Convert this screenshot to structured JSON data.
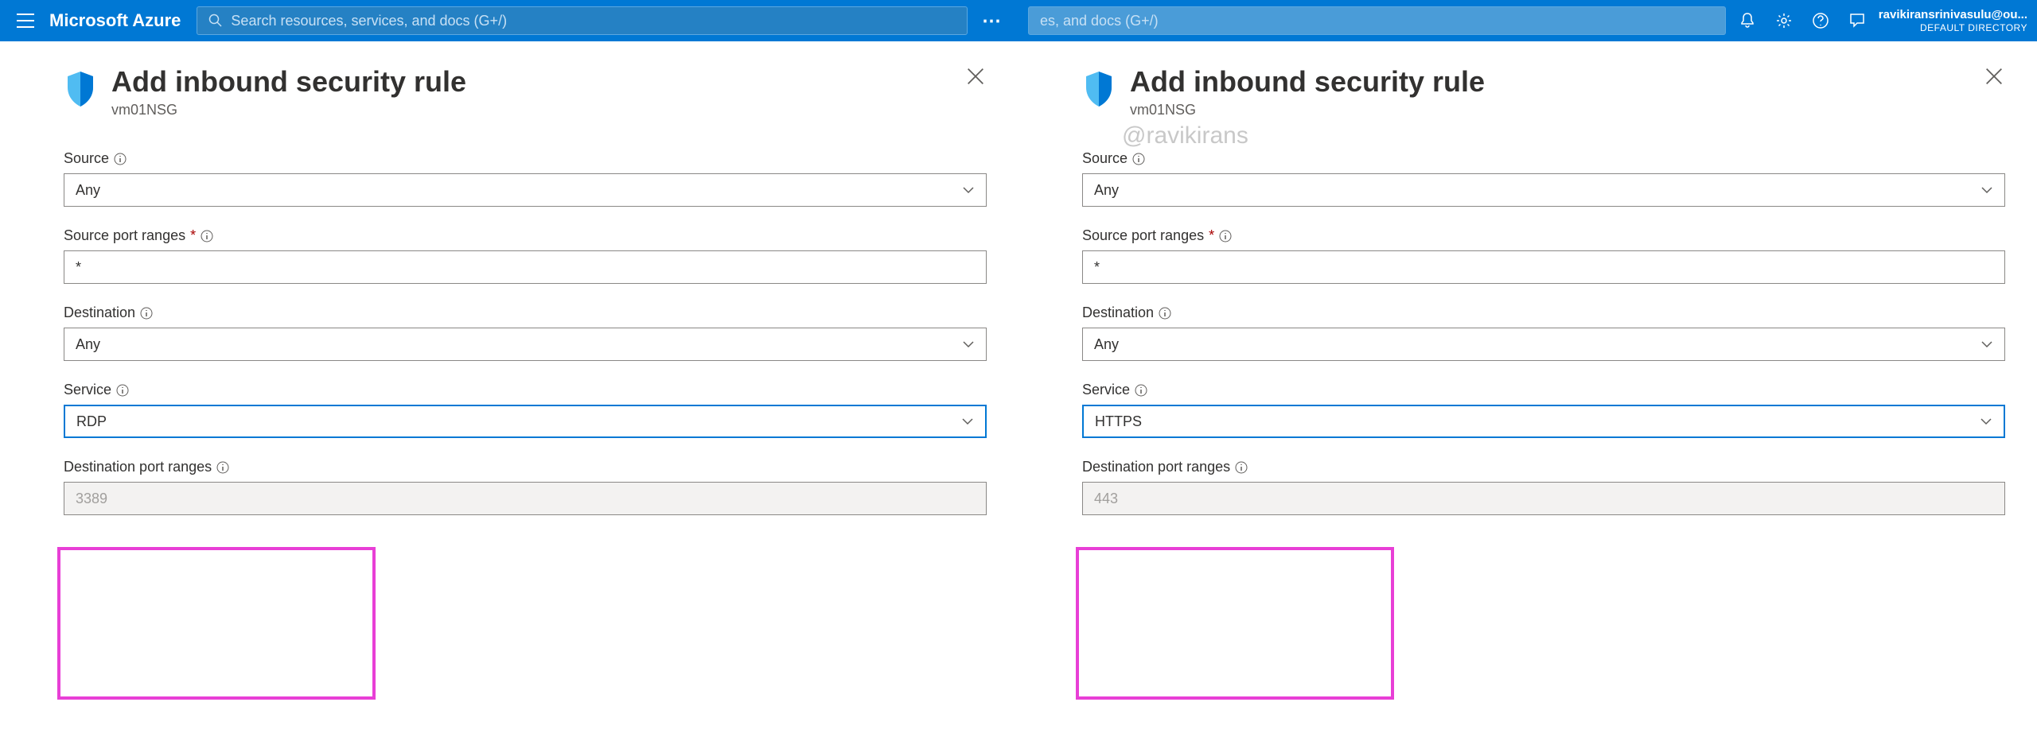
{
  "topbar": {
    "brand": "Microsoft Azure",
    "search_placeholder": "Search resources, services, and docs (G+/)",
    "search_placeholder_cut": "es, and docs (G+/)",
    "user_email": "ravikiransrinivasulu@ou...",
    "user_directory": "DEFAULT DIRECTORY"
  },
  "page": {
    "title": "Add inbound security rule",
    "subtitle": "vm01NSG",
    "watermark": "@ravikirans"
  },
  "left": {
    "fields": {
      "source": {
        "label": "Source",
        "value": "Any"
      },
      "source_port": {
        "label": "Source port ranges",
        "value": "*"
      },
      "destination": {
        "label": "Destination",
        "value": "Any"
      },
      "service": {
        "label": "Service",
        "value": "RDP"
      },
      "dest_port": {
        "label": "Destination port ranges",
        "value": "3389"
      }
    }
  },
  "right": {
    "fields": {
      "source": {
        "label": "Source",
        "value": "Any"
      },
      "source_port": {
        "label": "Source port ranges",
        "value": "*"
      },
      "destination": {
        "label": "Destination",
        "value": "Any"
      },
      "service": {
        "label": "Service",
        "value": "HTTPS"
      },
      "dest_port": {
        "label": "Destination port ranges",
        "value": "443"
      }
    }
  }
}
